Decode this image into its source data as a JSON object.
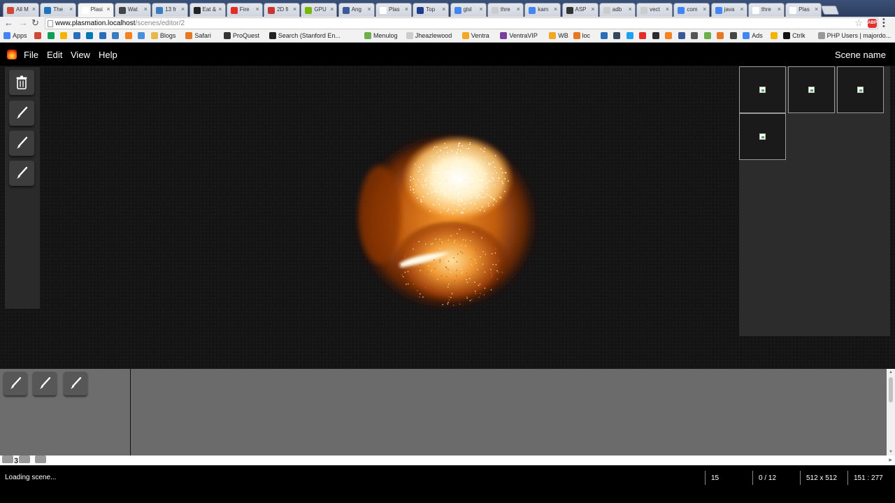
{
  "browser": {
    "tabs": [
      {
        "title": "All M",
        "color": "#d14836"
      },
      {
        "title": "The",
        "color": "#1e73be"
      },
      {
        "title": "Plasi",
        "color": "#ffffff",
        "active": true
      },
      {
        "title": "Wat",
        "color": "#444444"
      },
      {
        "title": "13 fr",
        "color": "#3b7bbf"
      },
      {
        "title": "Eat &",
        "color": "#222222"
      },
      {
        "title": "Fire",
        "color": "#e52d27"
      },
      {
        "title": "2D fi",
        "color": "#cc3333"
      },
      {
        "title": "GPU",
        "color": "#76b900"
      },
      {
        "title": "Ang",
        "color": "#3b5998"
      },
      {
        "title": "Plas",
        "color": "#ffffff"
      },
      {
        "title": "Top",
        "color": "#1d3c8c"
      },
      {
        "title": "glsl",
        "color": "#4285f4"
      },
      {
        "title": "thre",
        "color": "#cccccc"
      },
      {
        "title": "kam",
        "color": "#4285f4"
      },
      {
        "title": "ASP",
        "color": "#333333"
      },
      {
        "title": "adb",
        "color": "#cccccc"
      },
      {
        "title": "vect",
        "color": "#cccccc"
      },
      {
        "title": "com",
        "color": "#4285f4"
      },
      {
        "title": "java",
        "color": "#4285f4"
      },
      {
        "title": "thre",
        "color": "#ffffff"
      },
      {
        "title": "Plas",
        "color": "#ffffff"
      }
    ],
    "url_host": "www.plasmation.localhost",
    "url_path": "/scenes/editor/2",
    "bookmarks": [
      {
        "label": "Apps",
        "color": "#4285f4"
      },
      {
        "label": "",
        "color": "#d14836"
      },
      {
        "label": "",
        "color": "#0f9d58"
      },
      {
        "label": "",
        "color": "#f4b400"
      },
      {
        "label": "",
        "color": "#2a6ebb"
      },
      {
        "label": "",
        "color": "#0077b5"
      },
      {
        "label": "",
        "color": "#2a6ebb"
      },
      {
        "label": "",
        "color": "#3b7bbf"
      },
      {
        "label": "",
        "color": "#f58220"
      },
      {
        "label": "",
        "color": "#4a90d9"
      },
      {
        "label": "Blogs",
        "color": "#e8b84a"
      },
      {
        "label": "Safari",
        "color": "#e87722"
      },
      {
        "label": "ProQuest",
        "color": "#333333"
      },
      {
        "label": "Search (Stanford En...",
        "color": "#222222"
      },
      {
        "label": "Menulog",
        "color": "#6ab04c"
      },
      {
        "label": "Jheazlewood",
        "color": "#cccccc"
      },
      {
        "label": "Ventra",
        "color": "#f5a623"
      },
      {
        "label": "VentraVIP",
        "color": "#7b3f9e"
      },
      {
        "label": "WB",
        "color": "#f5a623"
      },
      {
        "label": "loc",
        "color": "#e87722"
      },
      {
        "label": "",
        "color": "#2a6ebb"
      },
      {
        "label": "",
        "color": "#35465c"
      },
      {
        "label": "",
        "color": "#1da1f2"
      },
      {
        "label": "",
        "color": "#e52d27"
      },
      {
        "label": "",
        "color": "#2b2b2b"
      },
      {
        "label": "",
        "color": "#f58220"
      },
      {
        "label": "",
        "color": "#3b5998"
      },
      {
        "label": "",
        "color": "#555555"
      },
      {
        "label": "",
        "color": "#6ab04c"
      },
      {
        "label": "",
        "color": "#e87722"
      },
      {
        "label": "",
        "color": "#444444"
      },
      {
        "label": "Ads",
        "color": "#4285f4"
      },
      {
        "label": "",
        "color": "#f4b400"
      },
      {
        "label": "Ctrlk",
        "color": "#111111"
      },
      {
        "label": "PHP Users | majordo...",
        "color": "#999999"
      }
    ]
  },
  "app": {
    "menu": [
      "File",
      "Edit",
      "View",
      "Help"
    ],
    "scene_name": "Scene name",
    "tools": [
      "delete-tool",
      "brush-tool",
      "brush-tool",
      "brush-tool"
    ],
    "thumbnails": 4,
    "timeline_tools": 3,
    "frame_number": "3",
    "status": "Loading scene...",
    "stats": [
      "15",
      "0 / 12",
      "512 x 512",
      "151 : 277"
    ],
    "colors": {
      "menubar": "#000000",
      "workspace": "#141414",
      "panel": "#2a2a2a",
      "timeline": "#6b6b6b",
      "fire_core": "#fff7e0",
      "fire_mid": "#ff9b2a",
      "fire_outer": "#a33a06"
    }
  }
}
